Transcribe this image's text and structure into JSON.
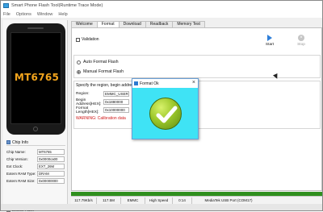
{
  "window": {
    "title": "Smart Phone Flash Tool(Runtime Trace Mode)"
  },
  "menu": [
    "File",
    "Options",
    "Window",
    "Help"
  ],
  "device": {
    "chip_label": "MT6765"
  },
  "chip_info": {
    "header": "Chip Info",
    "rows": [
      {
        "label": "Chip Name:",
        "value": "MT6765"
      },
      {
        "label": "Chip Version:",
        "value": "0x0000ca00"
      },
      {
        "label": "Ext Clock:",
        "value": "EXT_26M"
      },
      {
        "label": "Extern RAM Type:",
        "value": "DRAM"
      },
      {
        "label": "Extern RAM Size:",
        "value": "0x00000000"
      }
    ],
    "emmc_flash": "EMMC Flash"
  },
  "tabs": [
    "Welcome",
    "Format",
    "Download",
    "Readback",
    "Memory Test"
  ],
  "active_tab": "Format",
  "format": {
    "validation_label": "Validation",
    "start_label": "Start",
    "stop_label": "Stop",
    "options": [
      {
        "label": "Auto Format Flash",
        "selected": false
      },
      {
        "label": "Manual Format Flash",
        "selected": true
      }
    ],
    "spec_text": "Specify the region, begin address",
    "fields": [
      {
        "label": "Region:",
        "value": "EMMC_USER"
      },
      {
        "label": "Begin Address[HEX]:",
        "value": "0x1880000"
      },
      {
        "label": "Format Length[HEX]:",
        "value": "0x10000000"
      }
    ],
    "warning": "WARNING: Calibration data"
  },
  "dialog": {
    "title": "Format Ok",
    "close": "×",
    "icon": "green-checkmark-icon"
  },
  "progress": {
    "fill": 1.0,
    "color": "#2f8f1e"
  },
  "status": {
    "speed": "117.79Kb/s",
    "size": "117.5M",
    "storage": "EMMC",
    "usb_speed": "High Speed",
    "time": "0:14",
    "port": "MediaTek USB Port (COM17)"
  }
}
